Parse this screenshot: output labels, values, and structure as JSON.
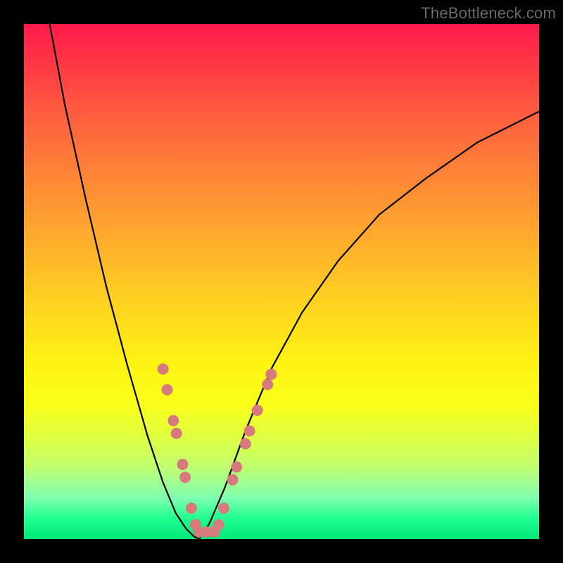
{
  "watermark": "TheBottleneck.com",
  "chart_data": {
    "type": "line",
    "title": "",
    "xlabel": "",
    "ylabel": "",
    "xlim": [
      0,
      100
    ],
    "ylim": [
      0,
      100
    ],
    "series": [
      {
        "name": "left-curve",
        "color": "#000000",
        "x": [
          5,
          8,
          12,
          16,
          20,
          24,
          27,
          29.5,
          31.5,
          33,
          34
        ],
        "y": [
          100,
          84,
          66,
          49,
          34,
          20,
          11,
          5,
          2,
          0.5,
          0
        ]
      },
      {
        "name": "right-curve",
        "color": "#000000",
        "x": [
          34,
          36,
          39,
          43,
          48,
          54,
          61,
          69,
          78,
          88,
          100
        ],
        "y": [
          0,
          3,
          10,
          21,
          33,
          44,
          54,
          63,
          70,
          77,
          83
        ]
      }
    ],
    "markers": {
      "name": "scatter-points",
      "color": "#d77a7d",
      "radius_px": 8,
      "points": [
        {
          "x": 27.0,
          "y": 33.0
        },
        {
          "x": 27.8,
          "y": 29.0
        },
        {
          "x": 29.0,
          "y": 23.0
        },
        {
          "x": 29.6,
          "y": 20.5
        },
        {
          "x": 30.8,
          "y": 14.5
        },
        {
          "x": 31.3,
          "y": 12.0
        },
        {
          "x": 32.5,
          "y": 6.0
        },
        {
          "x": 33.3,
          "y": 2.8
        },
        {
          "x": 34.0,
          "y": 1.4
        },
        {
          "x": 35.5,
          "y": 1.4
        },
        {
          "x": 37.0,
          "y": 1.4
        },
        {
          "x": 37.8,
          "y": 2.8
        },
        {
          "x": 38.8,
          "y": 6.0
        },
        {
          "x": 40.5,
          "y": 11.5
        },
        {
          "x": 41.3,
          "y": 14.0
        },
        {
          "x": 43.0,
          "y": 18.5
        },
        {
          "x": 43.8,
          "y": 21.0
        },
        {
          "x": 45.3,
          "y": 25.0
        },
        {
          "x": 47.3,
          "y": 30.0
        },
        {
          "x": 48.0,
          "y": 32.0
        }
      ]
    },
    "background_gradient": {
      "top": "#ff1a4b",
      "mid": "#fff314",
      "bottom": "#00e878"
    }
  }
}
